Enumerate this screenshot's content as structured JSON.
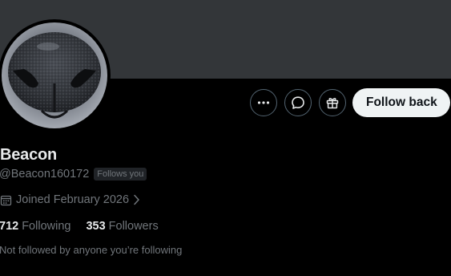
{
  "colors": {
    "background": "#000000",
    "banner": "#333639",
    "primary_text": "#e7e9ea",
    "secondary_text": "#71767b",
    "button_border": "#536471",
    "follow_button_bg": "#eff3f4",
    "follow_button_text": "#0f1419",
    "badge_bg": "#202327"
  },
  "profile": {
    "avatar_description": "close-up of a dog's nose",
    "display_name": "Beacon",
    "handle": "@Beacon160172",
    "follows_you_badge": "Follows you",
    "joined": "Joined February 2026",
    "following_count": "712",
    "following_label": "Following",
    "followers_count": "353",
    "followers_label": "Followers",
    "mutual_note": "Not followed by anyone you’re following"
  },
  "actions": {
    "more_icon": "more-icon",
    "message_icon": "message-icon",
    "gift_icon": "gift-icon",
    "follow_back_label": "Follow back"
  }
}
